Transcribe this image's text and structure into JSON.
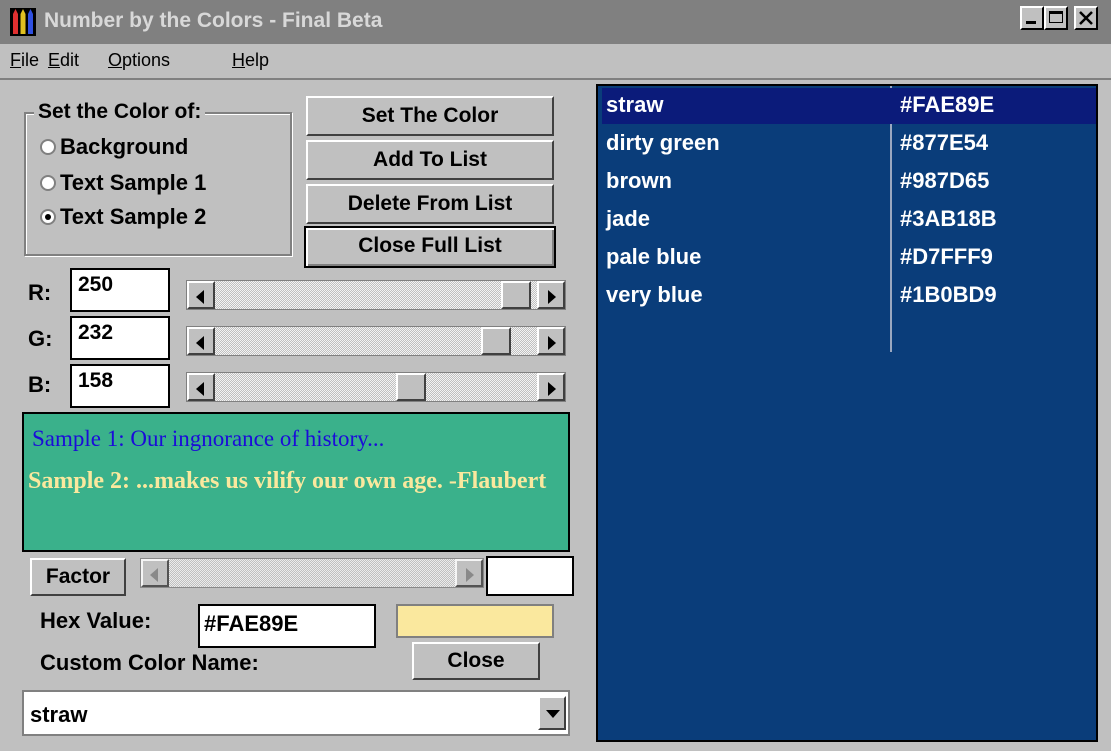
{
  "window": {
    "title": "Number by the Colors - Final Beta"
  },
  "menu": [
    {
      "accel": "F",
      "rest": "ile"
    },
    {
      "accel": "E",
      "rest": "dit"
    },
    {
      "accel": "O",
      "rest": "ptions"
    },
    {
      "accel": "H",
      "rest": "elp"
    }
  ],
  "set_color_group": {
    "legend": "Set the Color of:",
    "options": [
      "Background",
      "Text Sample 1",
      "Text Sample 2"
    ],
    "selected_index": 2
  },
  "buttons": {
    "set_color": "Set The Color",
    "add_to_list": "Add To List",
    "delete_from_list": "Delete From List",
    "close_full_list": "Close Full List",
    "factor": "Factor",
    "close": "Close"
  },
  "rgb": {
    "r_label": "R:",
    "r_value": "250",
    "g_label": "G:",
    "g_value": "232",
    "b_label": "B:",
    "b_value": "158"
  },
  "samples": {
    "sample1": "Sample 1: Our ingnorance of history...",
    "sample2": "Sample 2: ...makes us vilify our own age.    -Flaubert",
    "background_color": "#3AB18B",
    "sample1_color": "#1B0BD9",
    "sample2_color": "#FAE89E"
  },
  "hex": {
    "label": "Hex Value:",
    "value": "#FAE89E",
    "swatch_color": "#FAE89E"
  },
  "custom_name": {
    "label": "Custom Color Name:",
    "value": "straw"
  },
  "color_list": [
    {
      "name": "straw",
      "hex": "#FAE89E",
      "selected": true
    },
    {
      "name": "dirty green",
      "hex": "#877E54"
    },
    {
      "name": "brown",
      "hex": "#987D65"
    },
    {
      "name": "jade",
      "hex": "#3AB18B"
    },
    {
      "name": "pale blue",
      "hex": "#D7FFF9"
    },
    {
      "name": "very blue",
      "hex": "#1B0BD9"
    }
  ],
  "icons": {
    "app": "crayons-icon",
    "minimize": "minimize-icon",
    "maximize": "maximize-icon",
    "close": "close-icon"
  }
}
